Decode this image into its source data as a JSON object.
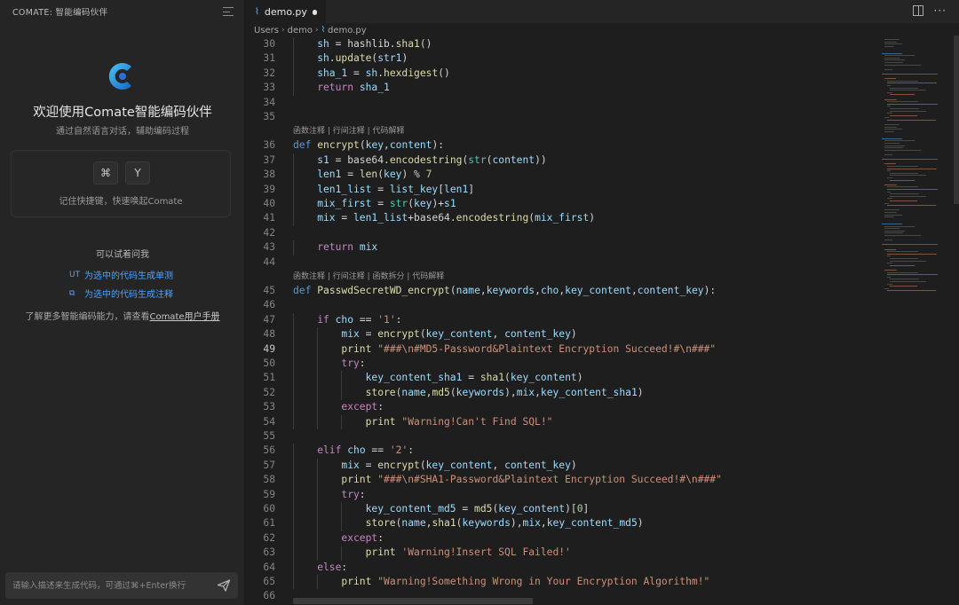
{
  "sidebar": {
    "title": "COMATE: 智能编码伙伴",
    "welcome_title": "欢迎使用Comate智能编码伙伴",
    "welcome_sub": "通过自然语言对话，辅助编码过程",
    "shortcut_keys": [
      "⌘",
      "Y"
    ],
    "shortcut_text": "记住快捷键，快速唤起Comate",
    "try_title": "可以试着问我",
    "try_links": [
      {
        "icon": "UT",
        "label": "为选中的代码生成单测"
      },
      {
        "icon": "⧉",
        "label": "为选中的代码生成注释"
      }
    ],
    "learn_more_prefix": "了解更多智能编码能力，请查看",
    "learn_more_link": "Comate用户手册",
    "chat_placeholder": "请输入描述来生成代码，可通过⌘+Enter换行"
  },
  "editor": {
    "tab_label": "demo.py",
    "tab_icon": "py",
    "breadcrumb": [
      "Users",
      "demo",
      "demo.py"
    ],
    "code_lens": [
      {
        "before_line": 36,
        "text": "函数注释 | 行间注释 | 代码解释"
      },
      {
        "before_line": 45,
        "text": "函数注释 | 行间注释 | 函数拆分 | 代码解释"
      }
    ],
    "active_line": 49,
    "lines": [
      {
        "n": 30,
        "indent": 1,
        "tokens": [
          [
            "var",
            "sh"
          ],
          [
            "",
            " = hashlib."
          ],
          [
            "fn",
            "sha1"
          ],
          [
            "",
            "()"
          ]
        ]
      },
      {
        "n": 31,
        "indent": 1,
        "tokens": [
          [
            "var",
            "sh"
          ],
          [
            "",
            "."
          ],
          [
            "fn",
            "update"
          ],
          [
            "",
            "("
          ],
          [
            "var",
            "str1"
          ],
          [
            "",
            ")"
          ]
        ]
      },
      {
        "n": 32,
        "indent": 1,
        "tokens": [
          [
            "var",
            "sha_1"
          ],
          [
            "",
            " = "
          ],
          [
            "var",
            "sh"
          ],
          [
            "",
            "."
          ],
          [
            "fn",
            "hexdigest"
          ],
          [
            "",
            "()"
          ]
        ]
      },
      {
        "n": 33,
        "indent": 1,
        "tokens": [
          [
            "kw",
            "return"
          ],
          [
            "",
            " "
          ],
          [
            "var",
            "sha_1"
          ]
        ]
      },
      {
        "n": 34,
        "indent": 0,
        "tokens": []
      },
      {
        "n": 35,
        "indent": 0,
        "tokens": []
      },
      {
        "n": 36,
        "indent": 0,
        "tokens": [
          [
            "def",
            "def"
          ],
          [
            "",
            " "
          ],
          [
            "fn",
            "encrypt"
          ],
          [
            "",
            "("
          ],
          [
            "var",
            "key"
          ],
          [
            "",
            ","
          ],
          [
            "var",
            "content"
          ],
          [
            "",
            "):"
          ]
        ]
      },
      {
        "n": 37,
        "indent": 1,
        "tokens": [
          [
            "var",
            "s1"
          ],
          [
            "",
            " = base64."
          ],
          [
            "fn",
            "encodestring"
          ],
          [
            "",
            "("
          ],
          [
            "bi",
            "str"
          ],
          [
            "",
            "("
          ],
          [
            "var",
            "content"
          ],
          [
            "",
            "))"
          ]
        ]
      },
      {
        "n": 38,
        "indent": 1,
        "tokens": [
          [
            "var",
            "len1"
          ],
          [
            "",
            " = "
          ],
          [
            "fn",
            "len"
          ],
          [
            "",
            "("
          ],
          [
            "var",
            "key"
          ],
          [
            "",
            ") % "
          ],
          [
            "num",
            "7"
          ]
        ]
      },
      {
        "n": 39,
        "indent": 1,
        "tokens": [
          [
            "var",
            "len1_list"
          ],
          [
            "",
            " = "
          ],
          [
            "var",
            "list_key"
          ],
          [
            "",
            "["
          ],
          [
            "var",
            "len1"
          ],
          [
            "",
            "]"
          ]
        ]
      },
      {
        "n": 40,
        "indent": 1,
        "tokens": [
          [
            "var",
            "mix_first"
          ],
          [
            "",
            " = "
          ],
          [
            "bi",
            "str"
          ],
          [
            "",
            "("
          ],
          [
            "var",
            "key"
          ],
          [
            "",
            ")+"
          ],
          [
            "var",
            "s1"
          ]
        ]
      },
      {
        "n": 41,
        "indent": 1,
        "tokens": [
          [
            "var",
            "mix"
          ],
          [
            "",
            " = "
          ],
          [
            "var",
            "len1_list"
          ],
          [
            "",
            "+base64."
          ],
          [
            "fn",
            "encodestring"
          ],
          [
            "",
            "("
          ],
          [
            "var",
            "mix_first"
          ],
          [
            "",
            ")"
          ]
        ]
      },
      {
        "n": 42,
        "indent": 0,
        "tokens": []
      },
      {
        "n": 43,
        "indent": 1,
        "tokens": [
          [
            "kw",
            "return"
          ],
          [
            "",
            " "
          ],
          [
            "var",
            "mix"
          ]
        ]
      },
      {
        "n": 44,
        "indent": 0,
        "tokens": []
      },
      {
        "n": 45,
        "indent": 0,
        "tokens": [
          [
            "def",
            "def"
          ],
          [
            "",
            " "
          ],
          [
            "fn",
            "PasswdSecretWD_encrypt"
          ],
          [
            "",
            "("
          ],
          [
            "var",
            "name"
          ],
          [
            "",
            ","
          ],
          [
            "var",
            "keywords"
          ],
          [
            "",
            ","
          ],
          [
            "var",
            "cho"
          ],
          [
            "",
            ","
          ],
          [
            "var",
            "key_content"
          ],
          [
            "",
            ","
          ],
          [
            "var",
            "content_key"
          ],
          [
            "",
            "):"
          ]
        ]
      },
      {
        "n": 46,
        "indent": 0,
        "tokens": []
      },
      {
        "n": 47,
        "indent": 1,
        "tokens": [
          [
            "kw",
            "if"
          ],
          [
            "",
            " "
          ],
          [
            "var",
            "cho"
          ],
          [
            "",
            " == "
          ],
          [
            "str",
            "'1'"
          ],
          [
            "",
            ":"
          ]
        ]
      },
      {
        "n": 48,
        "indent": 2,
        "tokens": [
          [
            "var",
            "mix"
          ],
          [
            "",
            " = "
          ],
          [
            "fn",
            "encrypt"
          ],
          [
            "",
            "("
          ],
          [
            "var",
            "key_content"
          ],
          [
            "",
            ", "
          ],
          [
            "var",
            "content_key"
          ],
          [
            "",
            ")"
          ]
        ]
      },
      {
        "n": 49,
        "indent": 2,
        "tokens": [
          [
            "fn",
            "print"
          ],
          [
            "",
            " "
          ],
          [
            "str",
            "\"###\\n#MD5-Password&Plaintext Encryption Succeed!#\\n###\""
          ]
        ]
      },
      {
        "n": 50,
        "indent": 2,
        "tokens": [
          [
            "kw",
            "try"
          ],
          [
            "",
            ":"
          ]
        ]
      },
      {
        "n": 51,
        "indent": 3,
        "tokens": [
          [
            "var",
            "key_content_sha1"
          ],
          [
            "",
            " = "
          ],
          [
            "fn",
            "sha1"
          ],
          [
            "",
            "("
          ],
          [
            "var",
            "key_content"
          ],
          [
            "",
            ")"
          ]
        ]
      },
      {
        "n": 52,
        "indent": 3,
        "tokens": [
          [
            "fn",
            "store"
          ],
          [
            "",
            "("
          ],
          [
            "var",
            "name"
          ],
          [
            "",
            ","
          ],
          [
            "fn",
            "md5"
          ],
          [
            "",
            "("
          ],
          [
            "var",
            "keywords"
          ],
          [
            "",
            "),"
          ],
          [
            "var",
            "mix"
          ],
          [
            "",
            ","
          ],
          [
            "var",
            "key_content_sha1"
          ],
          [
            "",
            ")"
          ]
        ]
      },
      {
        "n": 53,
        "indent": 2,
        "tokens": [
          [
            "kw",
            "except"
          ],
          [
            "",
            ":"
          ]
        ]
      },
      {
        "n": 54,
        "indent": 3,
        "tokens": [
          [
            "fn",
            "print"
          ],
          [
            "",
            " "
          ],
          [
            "str",
            "\"Warning!Can't Find SQL!\""
          ]
        ]
      },
      {
        "n": 55,
        "indent": 0,
        "tokens": []
      },
      {
        "n": 56,
        "indent": 1,
        "tokens": [
          [
            "kw",
            "elif"
          ],
          [
            "",
            " "
          ],
          [
            "var",
            "cho"
          ],
          [
            "",
            " == "
          ],
          [
            "str",
            "'2'"
          ],
          [
            "",
            ":"
          ]
        ]
      },
      {
        "n": 57,
        "indent": 2,
        "tokens": [
          [
            "var",
            "mix"
          ],
          [
            "",
            " = "
          ],
          [
            "fn",
            "encrypt"
          ],
          [
            "",
            "("
          ],
          [
            "var",
            "key_content"
          ],
          [
            "",
            ", "
          ],
          [
            "var",
            "content_key"
          ],
          [
            "",
            ")"
          ]
        ]
      },
      {
        "n": 58,
        "indent": 2,
        "tokens": [
          [
            "fn",
            "print"
          ],
          [
            "",
            " "
          ],
          [
            "str",
            "\"###\\n#SHA1-Password&Plaintext Encryption Succeed!#\\n###\""
          ]
        ]
      },
      {
        "n": 59,
        "indent": 2,
        "tokens": [
          [
            "kw",
            "try"
          ],
          [
            "",
            ":"
          ]
        ]
      },
      {
        "n": 60,
        "indent": 3,
        "tokens": [
          [
            "var",
            "key_content_md5"
          ],
          [
            "",
            " = "
          ],
          [
            "fn",
            "md5"
          ],
          [
            "",
            "("
          ],
          [
            "var",
            "key_content"
          ],
          [
            "",
            ")["
          ],
          [
            "num",
            "0"
          ],
          [
            "",
            "]"
          ]
        ]
      },
      {
        "n": 61,
        "indent": 3,
        "tokens": [
          [
            "fn",
            "store"
          ],
          [
            "",
            "("
          ],
          [
            "var",
            "name"
          ],
          [
            "",
            ","
          ],
          [
            "fn",
            "sha1"
          ],
          [
            "",
            "("
          ],
          [
            "var",
            "keywords"
          ],
          [
            "",
            "),"
          ],
          [
            "var",
            "mix"
          ],
          [
            "",
            ","
          ],
          [
            "var",
            "key_content_md5"
          ],
          [
            "",
            ")"
          ]
        ]
      },
      {
        "n": 62,
        "indent": 2,
        "tokens": [
          [
            "kw",
            "except"
          ],
          [
            "",
            ":"
          ]
        ]
      },
      {
        "n": 63,
        "indent": 3,
        "tokens": [
          [
            "fn",
            "print"
          ],
          [
            "",
            " "
          ],
          [
            "str",
            "'Warning!Insert SQL Failed!'"
          ]
        ]
      },
      {
        "n": 64,
        "indent": 1,
        "tokens": [
          [
            "kw",
            "else"
          ],
          [
            "",
            ":"
          ]
        ]
      },
      {
        "n": 65,
        "indent": 2,
        "tokens": [
          [
            "fn",
            "print"
          ],
          [
            "",
            " "
          ],
          [
            "str",
            "\"Warning!Something Wrong in Your Encryption Algorithm!\""
          ]
        ]
      },
      {
        "n": 66,
        "indent": 0,
        "tokens": []
      }
    ]
  }
}
